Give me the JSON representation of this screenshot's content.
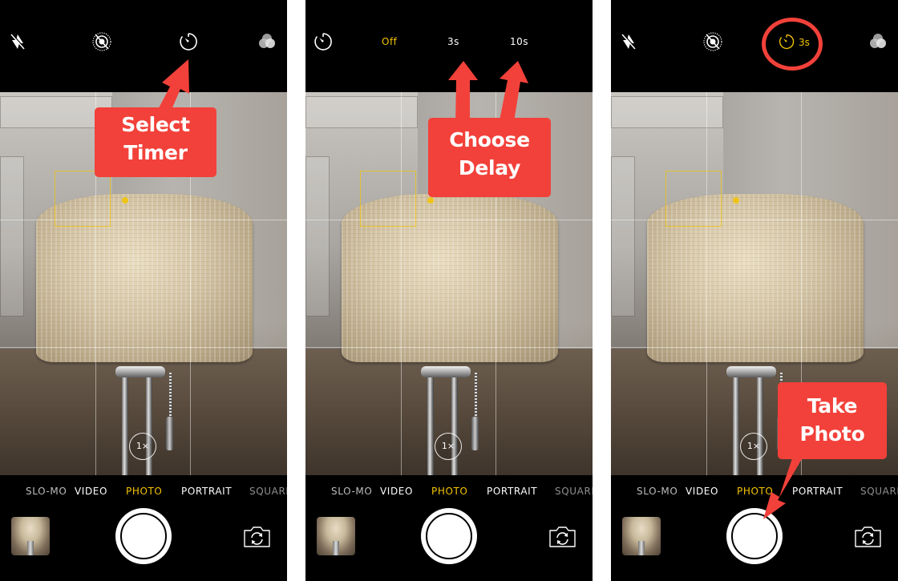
{
  "panels": [
    {
      "id": "step-select-timer",
      "top_icons": [
        "flash-off-icon",
        "live-photo-off-icon",
        "timer-icon",
        "filters-icon"
      ],
      "zoom_label": "1×",
      "modes": [
        "SLO-MO",
        "VIDEO",
        "PHOTO",
        "PORTRAIT",
        "SQUARE"
      ],
      "active_mode": "PHOTO",
      "callout": {
        "line1": "Select",
        "line2": "Timer"
      }
    },
    {
      "id": "step-choose-delay",
      "timer_options": [
        "Off",
        "3s",
        "10s"
      ],
      "selected_timer_option": "Off",
      "zoom_label": "1×",
      "modes": [
        "SLO-MO",
        "VIDEO",
        "PHOTO",
        "PORTRAIT",
        "SQUARE"
      ],
      "active_mode": "PHOTO",
      "callout": {
        "line1": "Choose",
        "line2": "Delay"
      }
    },
    {
      "id": "step-take-photo",
      "top_icons": [
        "flash-off-icon",
        "live-photo-off-icon",
        "timer-icon",
        "filters-icon"
      ],
      "timer_value": "3s",
      "zoom_label": "1×",
      "modes": [
        "SLO-MO",
        "VIDEO",
        "PHOTO",
        "PORTRAIT",
        "SQUARE"
      ],
      "active_mode": "PHOTO",
      "callout": {
        "line1": "Take",
        "line2": "Photo"
      }
    }
  ],
  "colors": {
    "annotation_red": "#f2413a",
    "active_yellow": "#f5c400",
    "background": "#000000"
  }
}
